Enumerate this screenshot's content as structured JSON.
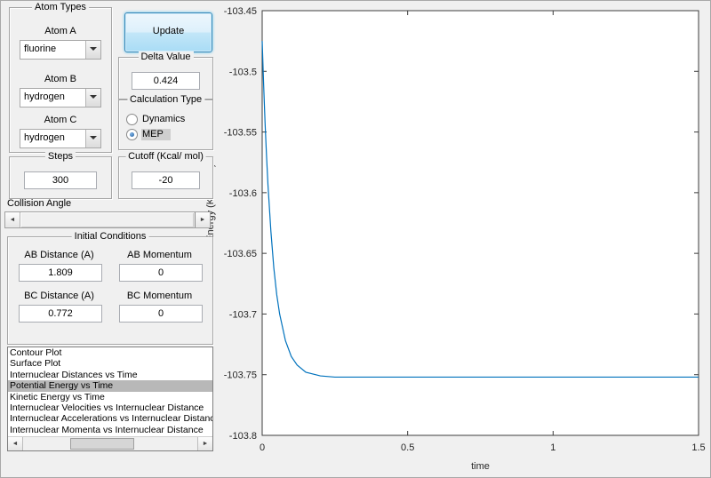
{
  "atom_types": {
    "title": "Atom Types",
    "atom_a": {
      "label": "Atom A",
      "value": "fluorine"
    },
    "atom_b": {
      "label": "Atom B",
      "value": "hydrogen"
    },
    "atom_c": {
      "label": "Atom C",
      "value": "hydrogen"
    }
  },
  "update_button": {
    "label": "Update"
  },
  "delta": {
    "title": "Delta Value",
    "value": "0.424"
  },
  "calculation_type": {
    "title": "Calculation Type",
    "options": [
      {
        "label": "Dynamics",
        "selected": false
      },
      {
        "label": "MEP",
        "selected": true
      }
    ]
  },
  "steps": {
    "title": "Steps",
    "value": "300"
  },
  "cutoff": {
    "title": "Cutoff (Kcal/ mol)",
    "value": "-20"
  },
  "collision_angle": {
    "label": "Collision Angle"
  },
  "initial_conditions": {
    "title": "Initial Conditions",
    "ab_distance": {
      "label": "AB Distance (A)",
      "value": "1.809"
    },
    "ab_momentum": {
      "label": "AB Momentum",
      "value": "0"
    },
    "bc_distance": {
      "label": "BC Distance (A)",
      "value": "0.772"
    },
    "bc_momentum": {
      "label": "BC Momentum",
      "value": "0"
    }
  },
  "plot_list": {
    "items": [
      "Contour Plot",
      "Surface Plot",
      "Internuclear Distances vs Time",
      "Potential Energy vs Time",
      "Kinetic Energy vs Time",
      "Internuclear Velocities vs Internuclear Distance",
      "Internuclear Accelerations vs Internuclear Distance",
      "Internuclear Momenta vs Internuclear Distance"
    ],
    "selected_index": 3
  },
  "chart_data": {
    "type": "line",
    "title": "",
    "xlabel": "time",
    "ylabel": "Potential Energy (Kcal/mol)",
    "xlim": [
      0,
      1.5
    ],
    "ylim": [
      -103.8,
      -103.45
    ],
    "xticks": [
      "0",
      "0.5",
      "1",
      "1.5"
    ],
    "yticks": [
      "-103.8",
      "-103.75",
      "-103.7",
      "-103.65",
      "-103.6",
      "-103.55",
      "-103.5",
      "-103.45"
    ],
    "grid": false,
    "legend": false,
    "line_color": "#0072BD",
    "series": [
      {
        "name": "Potential Energy vs Time",
        "x": [
          0,
          0.005,
          0.01,
          0.015,
          0.02,
          0.03,
          0.04,
          0.05,
          0.06,
          0.08,
          0.1,
          0.12,
          0.15,
          0.2,
          0.25,
          0.3,
          0.4,
          0.5,
          0.7,
          0.9,
          1.1,
          1.3,
          1.5
        ],
        "y": [
          -103.475,
          -103.511,
          -103.543,
          -103.57,
          -103.594,
          -103.632,
          -103.662,
          -103.684,
          -103.7,
          -103.722,
          -103.735,
          -103.742,
          -103.748,
          -103.751,
          -103.752,
          -103.752,
          -103.752,
          -103.752,
          -103.752,
          -103.752,
          -103.752,
          -103.752,
          -103.752
        ]
      }
    ]
  }
}
